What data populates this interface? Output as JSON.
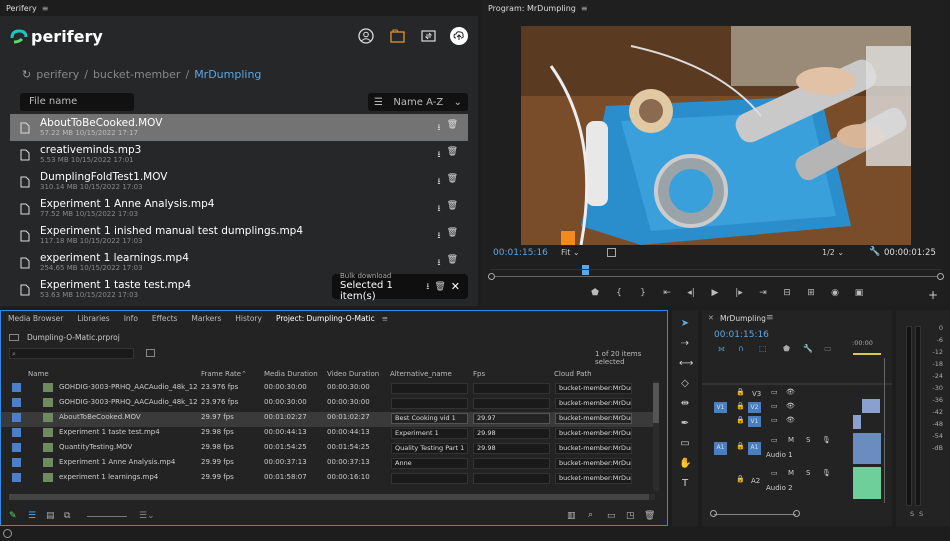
{
  "perifery_tab": {
    "title": "Perifery"
  },
  "perifery": {
    "logo_text": "perifery",
    "breadcrumb": [
      "perifery",
      "/",
      "bucket-member",
      "/",
      "MrDumpling"
    ],
    "search_placeholder": "File name",
    "sort_label": "Name A-Z",
    "files": [
      {
        "name": "AboutToBeCooked.MOV",
        "meta": "57.22 MB 10/15/2022 17:17",
        "selected": true
      },
      {
        "name": "creativeminds.mp3",
        "meta": "5.53 MB 10/15/2022 17:01"
      },
      {
        "name": "DumplingFoldTest1.MOV",
        "meta": "310.14 MB 10/15/2022 17:03"
      },
      {
        "name": "Experiment 1 Anne Analysis.mp4",
        "meta": "77.52 MB 10/15/2022 17:03"
      },
      {
        "name": "Experiment 1 inished manual test dumplings.mp4",
        "meta": "117.18 MB 10/15/2022 17:03"
      },
      {
        "name": "experiment 1 learnings.mp4",
        "meta": "254.65 MB 10/15/2022 17:03"
      },
      {
        "name": "Experiment 1 taste test.mp4",
        "meta": "53.63 MB 10/15/2022 17:03"
      }
    ],
    "bulk": {
      "title": "Bulk download",
      "status": "Selected 1 item(s)"
    }
  },
  "program": {
    "tab_title": "Program: MrDumpling",
    "timecode": "00:01:15:16",
    "fit": "Fit",
    "resolution": "1/2",
    "duration": "00:00:01:25"
  },
  "project": {
    "tabs": [
      "Media Browser",
      "Libraries",
      "Info",
      "Effects",
      "Markers",
      "History",
      "Project: Dumpling-O-Matic"
    ],
    "active_tab": "Project: Dumpling-O-Matic",
    "file": "Dumpling-O-Matic.prproj",
    "selection_info": "1 of 20 items selected",
    "columns": [
      "Name",
      "Frame Rate",
      "Media Duration",
      "Video Duration",
      "Alternative_name",
      "Fps",
      "Cloud Path"
    ],
    "rows": [
      {
        "name": "GOHDIG-3003-PRHQ_AACAudio_48k_128-1",
        "fr": "23.976 fps",
        "md": "00:00:30:00",
        "vd": "00:00:30:00",
        "alt": "",
        "fps": "",
        "cp": "bucket-member:MrDun"
      },
      {
        "name": "GOHDIG-3003-PRHQ_AACAudio_48k_128-1",
        "fr": "23.976 fps",
        "md": "00:00:30:00",
        "vd": "00:00:30:00",
        "alt": "",
        "fps": "",
        "cp": "bucket-member:MrDun"
      },
      {
        "name": "AboutToBeCooked.MOV",
        "fr": "29.97 fps",
        "md": "00:01:02:27",
        "vd": "00:01:02:27",
        "alt": "Best Cooking vid 1",
        "fps": "29.97",
        "cp": "bucket-member:MrDun",
        "selected": true
      },
      {
        "name": "Experiment 1 taste test.mp4",
        "fr": "29.98 fps",
        "md": "00:00:44:13",
        "vd": "00:00:44:13",
        "alt": "Experiment 1",
        "fps": "29.98",
        "cp": "bucket-member:MrDun"
      },
      {
        "name": "QuantityTesting.MOV",
        "fr": "29.98 fps",
        "md": "00:01:54:25",
        "vd": "00:01:54:25",
        "alt": "Quality Testing Part 1",
        "fps": "29.98",
        "cp": "bucket-member:MrDun"
      },
      {
        "name": "Experiment 1 Anne Analysis.mp4",
        "fr": "29.99 fps",
        "md": "00:00:37:13",
        "vd": "00:00:37:13",
        "alt": "Anne",
        "fps": "",
        "cp": "bucket-member:MrDun"
      },
      {
        "name": "experiment 1 learnings.mp4",
        "fr": "29.99 fps",
        "md": "00:01:58:07",
        "vd": "00:00:16:10",
        "alt": "",
        "fps": "",
        "cp": "bucket-member:MrDun"
      }
    ]
  },
  "timeline": {
    "title": "MrDumpling",
    "timecode": "00:01:15:16",
    "ruler": ":00:00",
    "tracks": [
      {
        "id": "V3",
        "tgl": ""
      },
      {
        "id": "V2",
        "tgl": "V1"
      },
      {
        "id": "V1",
        "tgl": ""
      },
      {
        "id": "A1",
        "tgl": "A1",
        "label": "Audio 1"
      },
      {
        "id": "A2",
        "tgl": "",
        "label": "Audio 2"
      }
    ],
    "m": "M",
    "s": "S"
  },
  "meters": {
    "scale": [
      "0",
      "-6",
      "-12",
      "-18",
      "-24",
      "-30",
      "-36",
      "-42",
      "-48",
      "-54",
      "-dB"
    ],
    "solo": [
      "S",
      "S"
    ]
  }
}
